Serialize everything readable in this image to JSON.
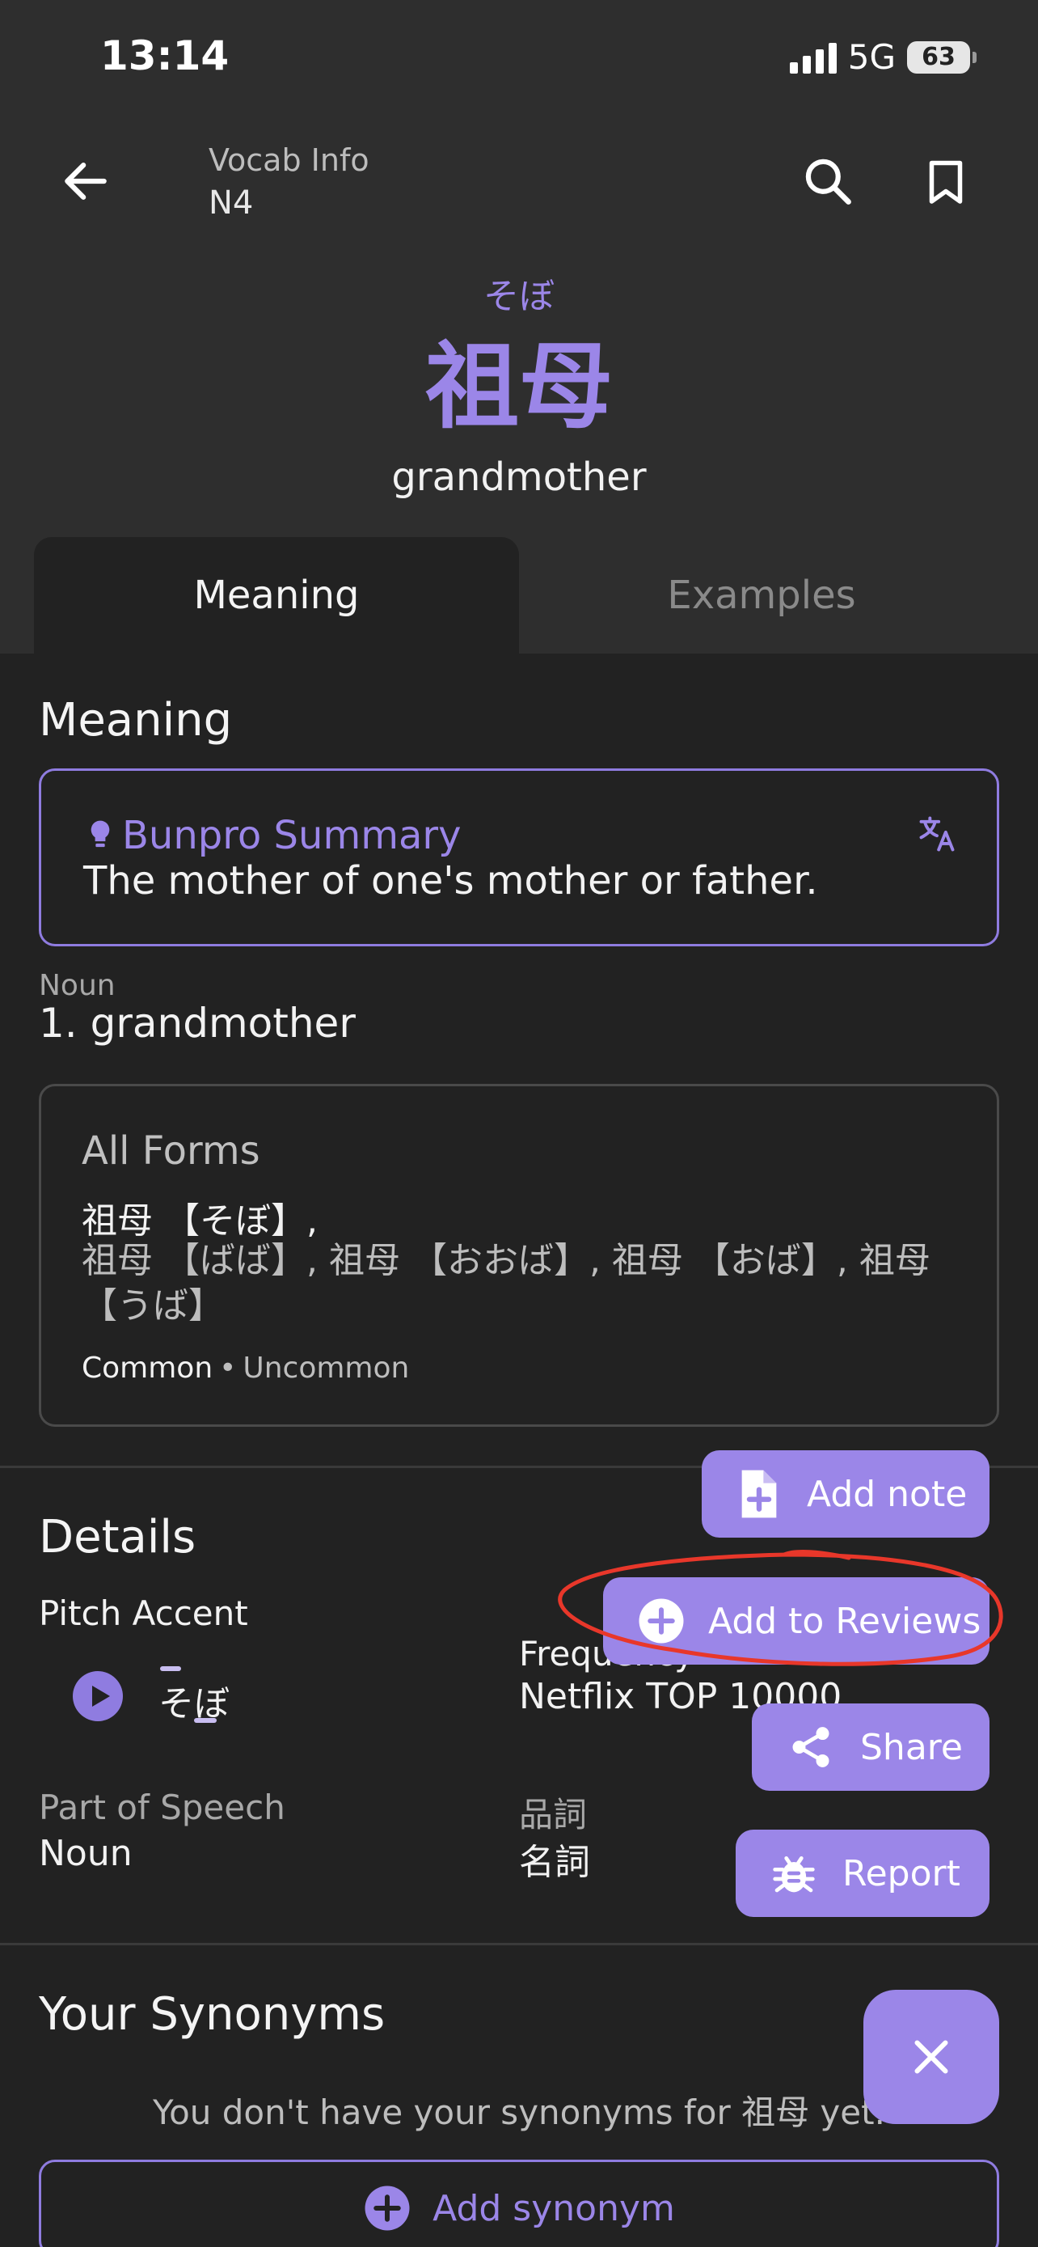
{
  "status_bar": {
    "time": "13:14",
    "network": "5G",
    "battery": "63"
  },
  "header": {
    "title": "Vocab Info",
    "level": "N4"
  },
  "word": {
    "furigana": "そぼ",
    "kanji": "祖母",
    "gloss": "grandmother"
  },
  "tabs": [
    {
      "label": "Meaning",
      "active": true
    },
    {
      "label": "Examples",
      "active": false
    }
  ],
  "meaning": {
    "heading": "Meaning",
    "summary_title": "Bunpro Summary",
    "summary_text": "The mother of one's mother or father.",
    "part_of_speech": "Noun",
    "definition": "1.  grandmother"
  },
  "all_forms": {
    "title": "All Forms",
    "common": "祖母 【そぼ】,",
    "uncommon": "祖母 【ばば】, 祖母 【おおば】, 祖母 【おば】, 祖母 【うば】",
    "legend_common": "Common",
    "legend_separator": "•",
    "legend_uncommon": "Uncommon"
  },
  "details": {
    "heading": "Details",
    "pitch_label": "Pitch Accent",
    "pitch_word": "そぼ",
    "frequency_label": "Frequency",
    "frequency_value": "Netflix TOP 10000",
    "pos_label": "Part of Speech",
    "pos_value": "Noun",
    "hinshi_label": "品詞",
    "hinshi_value": "名詞"
  },
  "actions": {
    "add_note": "Add note",
    "add_to_reviews": "Add to Reviews",
    "share": "Share",
    "report": "Report"
  },
  "synonyms": {
    "heading": "Your Synonyms",
    "empty": "You don't have your synonyms for 祖母 yet.",
    "add": "Add synonym"
  },
  "colors": {
    "accent": "#9b86e8",
    "background": "#222222",
    "header_bg": "#2e2e2e",
    "annotation": "#e8372a"
  }
}
